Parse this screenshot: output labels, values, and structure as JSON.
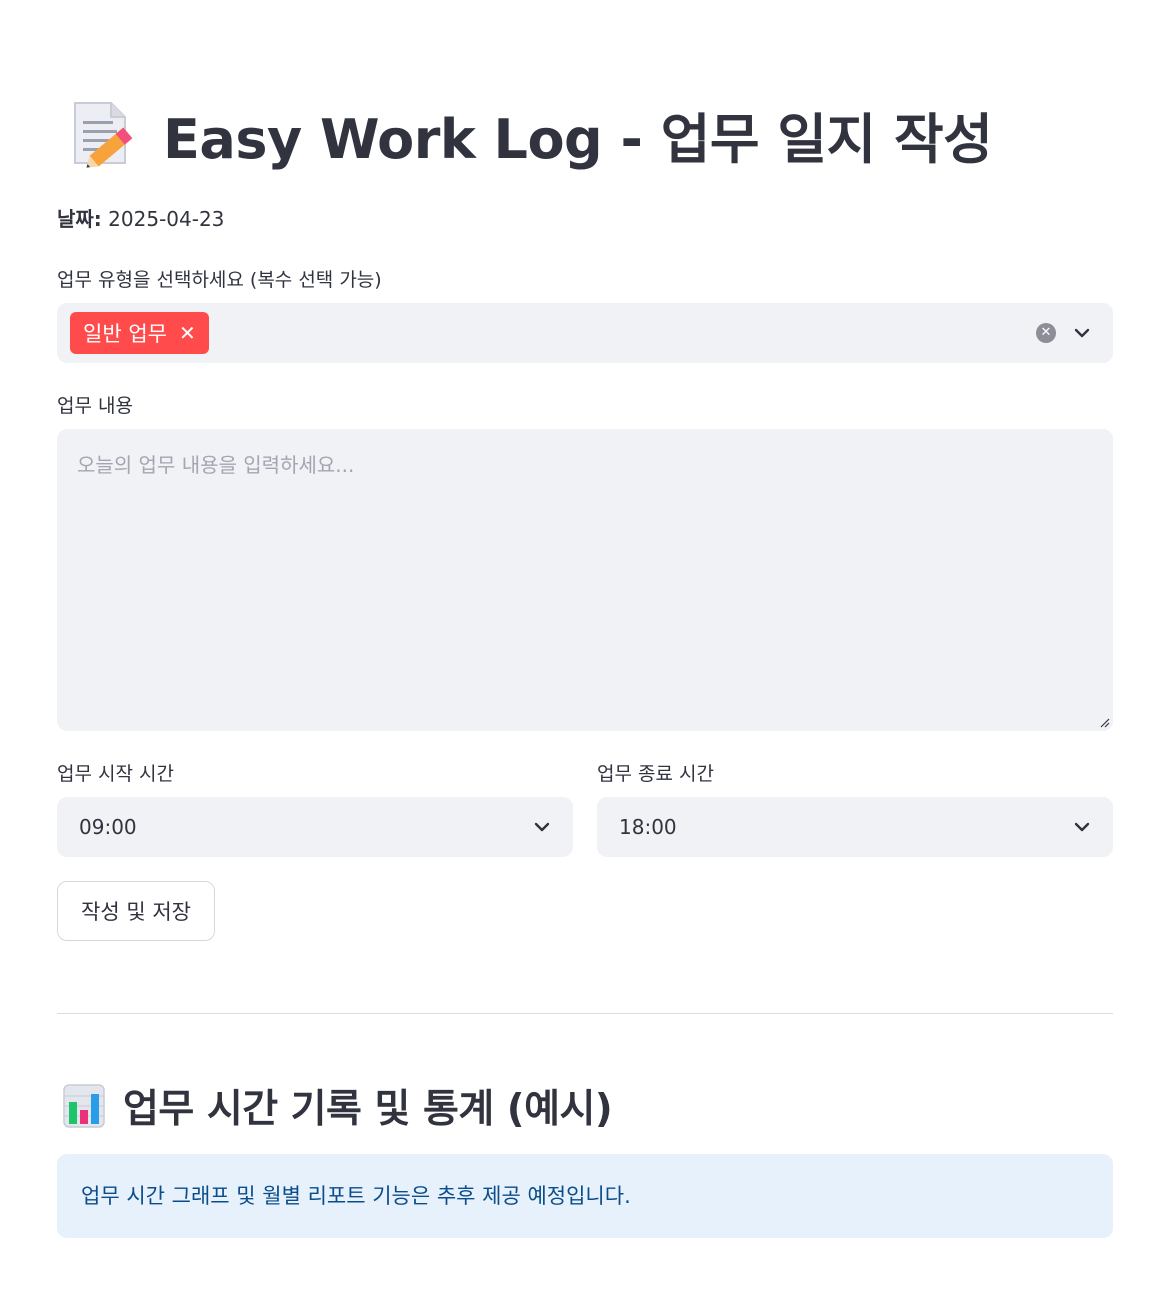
{
  "header": {
    "title": "Easy Work Log - 업무 일지 작성",
    "title_icon": "memo-icon"
  },
  "date": {
    "label": "날짜:",
    "value": "2025-04-23"
  },
  "work_type": {
    "label": "업무 유형을 선택하세요 (복수 선택 가능)",
    "selected": [
      "일반 업무"
    ],
    "tag_color": "#ff4b4b"
  },
  "work_content": {
    "label": "업무 내용",
    "value": "",
    "placeholder": "오늘의 업무 내용을 입력하세요..."
  },
  "start_time": {
    "label": "업무 시작 시간",
    "value": "09:00"
  },
  "end_time": {
    "label": "업무 종료 시간",
    "value": "18:00"
  },
  "save_button": {
    "label": "작성 및 저장"
  },
  "stats": {
    "title": "업무 시간 기록 및 통계 (예시)",
    "title_icon": "bar-chart-icon",
    "info": "업무 시간 그래프 및 월별 리포트 기능은 추후 제공 예정입니다.",
    "info_bg": "#e6f1fb",
    "info_text_color": "#0b4c8a"
  }
}
